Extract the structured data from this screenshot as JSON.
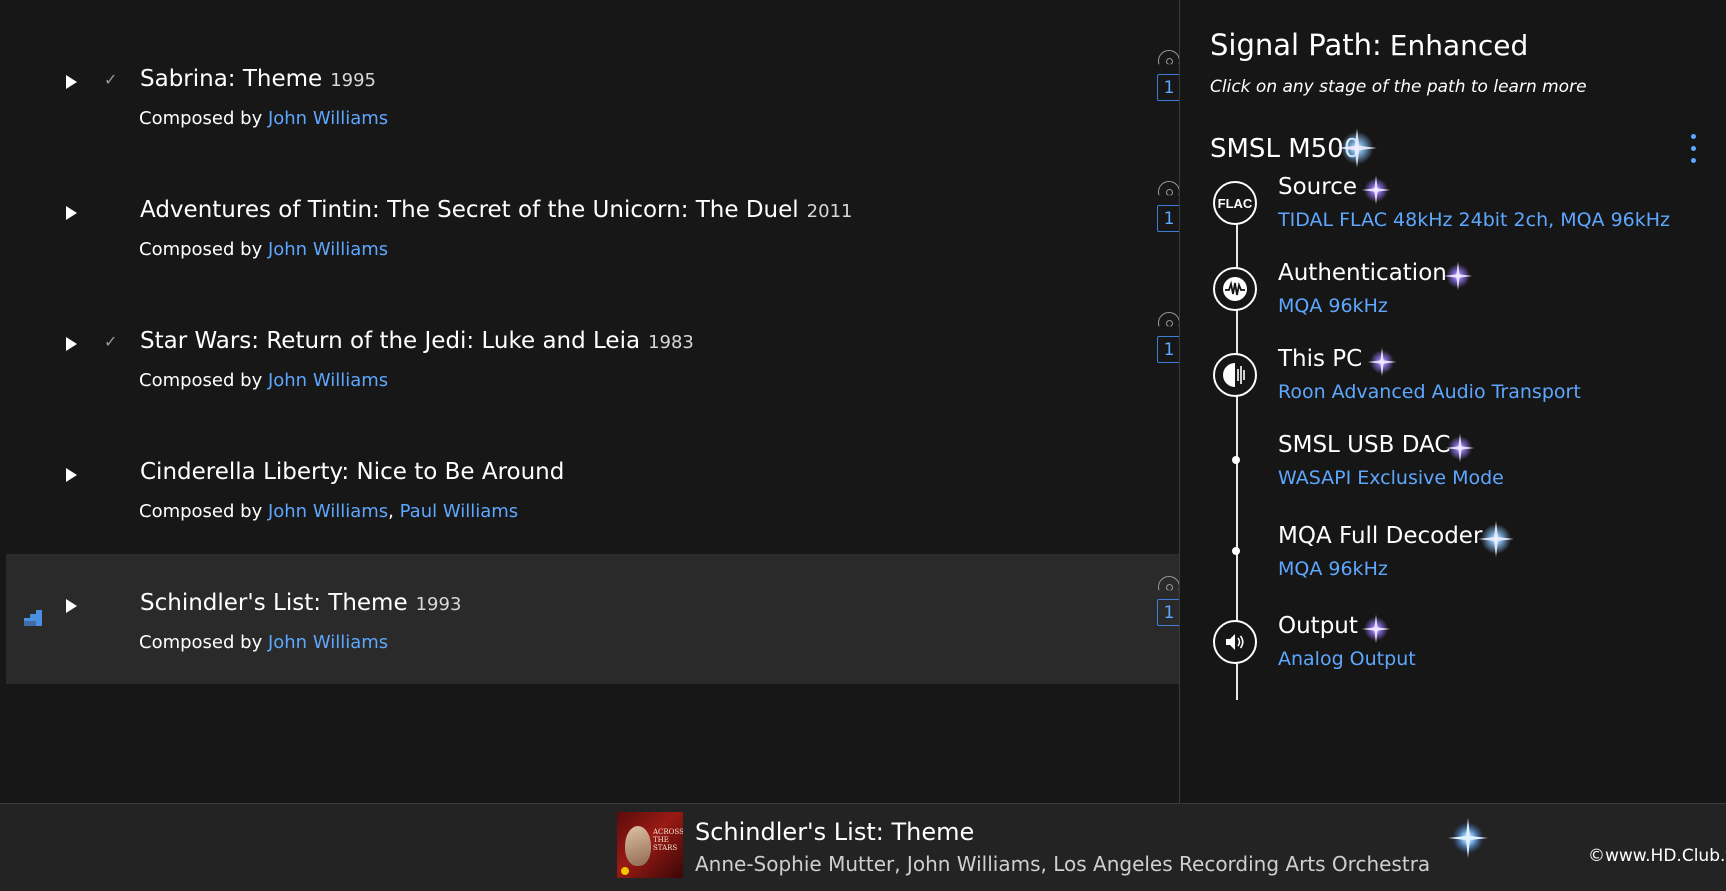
{
  "tracks": [
    {
      "title": "Sabrina: Theme",
      "year": "1995",
      "checked": true,
      "composed_prefix": "Composed by ",
      "composers": [
        "John Williams"
      ],
      "disc": "1"
    },
    {
      "title": "Adventures of Tintin: The Secret of the Unicorn: The Duel",
      "year": "2011",
      "checked": false,
      "composed_prefix": "Composed by ",
      "composers": [
        "John Williams"
      ],
      "disc": "1"
    },
    {
      "title": "Star Wars: Return of the Jedi: Luke and Leia",
      "year": "1983",
      "checked": true,
      "composed_prefix": "Composed by ",
      "composers": [
        "John Williams"
      ],
      "disc": "1"
    },
    {
      "title": "Cinderella Liberty: Nice to Be Around",
      "year": "",
      "checked": false,
      "composed_prefix": "Composed by ",
      "composers": [
        "John Williams",
        "Paul Williams"
      ],
      "disc": ""
    },
    {
      "title": "Schindler's List: Theme",
      "year": "1993",
      "checked": false,
      "composed_prefix": "Composed by ",
      "composers": [
        "John Williams"
      ],
      "disc": "1",
      "playing": true
    }
  ],
  "signal_path": {
    "title": "Signal Path:",
    "quality": "Enhanced",
    "subtitle": "Click on any stage of the path to learn more",
    "device": "SMSL M500",
    "stages": [
      {
        "name": "Source",
        "detail": "TIDAL FLAC 48kHz 24bit 2ch, MQA 96kHz",
        "icon": "flac-icon",
        "icon_text": "FLAC",
        "star": "purple"
      },
      {
        "name": "Authentication",
        "detail": "MQA 96kHz",
        "icon": "mqa-auth-icon",
        "star": "purple"
      },
      {
        "name": "This PC",
        "detail": "Roon Advanced Audio Transport",
        "icon": "raat-icon",
        "star": "purple"
      },
      {
        "name": "SMSL USB DAC",
        "detail": "WASAPI Exclusive Mode",
        "icon": "dot",
        "star": "purple"
      },
      {
        "name": "MQA Full Decoder",
        "detail": "MQA 96kHz",
        "icon": "dot",
        "star": "blue"
      },
      {
        "name": "Output",
        "detail": "Analog Output",
        "icon": "speaker-icon",
        "star": "purple"
      }
    ]
  },
  "now_playing": {
    "title": "Schindler's List: Theme",
    "artists": "Anne-Sophie Mutter, John Williams, Los Angeles Recording Arts Orchestra",
    "cover_text": "ACROSS THE STARS"
  },
  "watermark": "©www.HD.Club.tw",
  "colors": {
    "link": "#5ea7ff",
    "background": "#171717",
    "playing_row": "#2a2a2a",
    "star_purple": "#9b7bff",
    "star_blue": "#8cc8ff"
  }
}
